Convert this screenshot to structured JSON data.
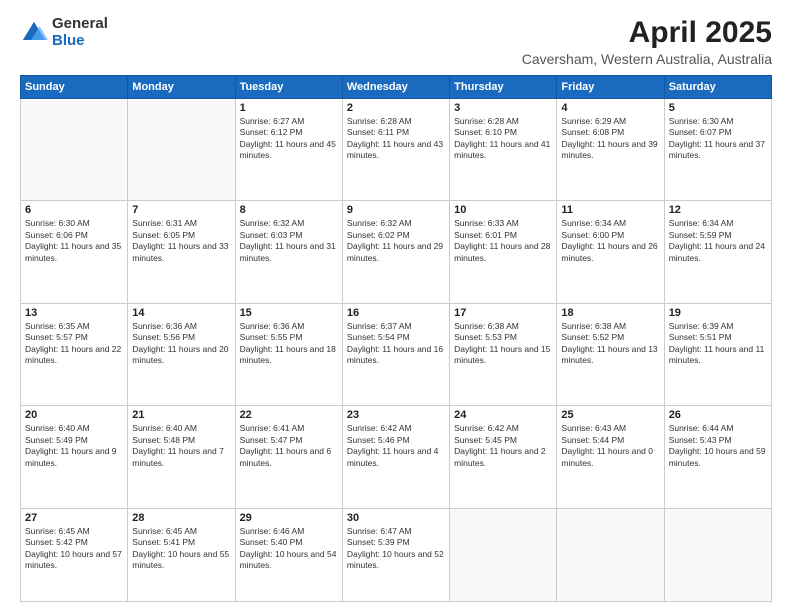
{
  "logo": {
    "general": "General",
    "blue": "Blue"
  },
  "title": {
    "month": "April 2025",
    "location": "Caversham, Western Australia, Australia"
  },
  "days_of_week": [
    "Sunday",
    "Monday",
    "Tuesday",
    "Wednesday",
    "Thursday",
    "Friday",
    "Saturday"
  ],
  "weeks": [
    [
      {
        "day": "",
        "info": ""
      },
      {
        "day": "",
        "info": ""
      },
      {
        "day": "1",
        "info": "Sunrise: 6:27 AM\nSunset: 6:12 PM\nDaylight: 11 hours and 45 minutes."
      },
      {
        "day": "2",
        "info": "Sunrise: 6:28 AM\nSunset: 6:11 PM\nDaylight: 11 hours and 43 minutes."
      },
      {
        "day": "3",
        "info": "Sunrise: 6:28 AM\nSunset: 6:10 PM\nDaylight: 11 hours and 41 minutes."
      },
      {
        "day": "4",
        "info": "Sunrise: 6:29 AM\nSunset: 6:08 PM\nDaylight: 11 hours and 39 minutes."
      },
      {
        "day": "5",
        "info": "Sunrise: 6:30 AM\nSunset: 6:07 PM\nDaylight: 11 hours and 37 minutes."
      }
    ],
    [
      {
        "day": "6",
        "info": "Sunrise: 6:30 AM\nSunset: 6:06 PM\nDaylight: 11 hours and 35 minutes."
      },
      {
        "day": "7",
        "info": "Sunrise: 6:31 AM\nSunset: 6:05 PM\nDaylight: 11 hours and 33 minutes."
      },
      {
        "day": "8",
        "info": "Sunrise: 6:32 AM\nSunset: 6:03 PM\nDaylight: 11 hours and 31 minutes."
      },
      {
        "day": "9",
        "info": "Sunrise: 6:32 AM\nSunset: 6:02 PM\nDaylight: 11 hours and 29 minutes."
      },
      {
        "day": "10",
        "info": "Sunrise: 6:33 AM\nSunset: 6:01 PM\nDaylight: 11 hours and 28 minutes."
      },
      {
        "day": "11",
        "info": "Sunrise: 6:34 AM\nSunset: 6:00 PM\nDaylight: 11 hours and 26 minutes."
      },
      {
        "day": "12",
        "info": "Sunrise: 6:34 AM\nSunset: 5:59 PM\nDaylight: 11 hours and 24 minutes."
      }
    ],
    [
      {
        "day": "13",
        "info": "Sunrise: 6:35 AM\nSunset: 5:57 PM\nDaylight: 11 hours and 22 minutes."
      },
      {
        "day": "14",
        "info": "Sunrise: 6:36 AM\nSunset: 5:56 PM\nDaylight: 11 hours and 20 minutes."
      },
      {
        "day": "15",
        "info": "Sunrise: 6:36 AM\nSunset: 5:55 PM\nDaylight: 11 hours and 18 minutes."
      },
      {
        "day": "16",
        "info": "Sunrise: 6:37 AM\nSunset: 5:54 PM\nDaylight: 11 hours and 16 minutes."
      },
      {
        "day": "17",
        "info": "Sunrise: 6:38 AM\nSunset: 5:53 PM\nDaylight: 11 hours and 15 minutes."
      },
      {
        "day": "18",
        "info": "Sunrise: 6:38 AM\nSunset: 5:52 PM\nDaylight: 11 hours and 13 minutes."
      },
      {
        "day": "19",
        "info": "Sunrise: 6:39 AM\nSunset: 5:51 PM\nDaylight: 11 hours and 11 minutes."
      }
    ],
    [
      {
        "day": "20",
        "info": "Sunrise: 6:40 AM\nSunset: 5:49 PM\nDaylight: 11 hours and 9 minutes."
      },
      {
        "day": "21",
        "info": "Sunrise: 6:40 AM\nSunset: 5:48 PM\nDaylight: 11 hours and 7 minutes."
      },
      {
        "day": "22",
        "info": "Sunrise: 6:41 AM\nSunset: 5:47 PM\nDaylight: 11 hours and 6 minutes."
      },
      {
        "day": "23",
        "info": "Sunrise: 6:42 AM\nSunset: 5:46 PM\nDaylight: 11 hours and 4 minutes."
      },
      {
        "day": "24",
        "info": "Sunrise: 6:42 AM\nSunset: 5:45 PM\nDaylight: 11 hours and 2 minutes."
      },
      {
        "day": "25",
        "info": "Sunrise: 6:43 AM\nSunset: 5:44 PM\nDaylight: 11 hours and 0 minutes."
      },
      {
        "day": "26",
        "info": "Sunrise: 6:44 AM\nSunset: 5:43 PM\nDaylight: 10 hours and 59 minutes."
      }
    ],
    [
      {
        "day": "27",
        "info": "Sunrise: 6:45 AM\nSunset: 5:42 PM\nDaylight: 10 hours and 57 minutes."
      },
      {
        "day": "28",
        "info": "Sunrise: 6:45 AM\nSunset: 5:41 PM\nDaylight: 10 hours and 55 minutes."
      },
      {
        "day": "29",
        "info": "Sunrise: 6:46 AM\nSunset: 5:40 PM\nDaylight: 10 hours and 54 minutes."
      },
      {
        "day": "30",
        "info": "Sunrise: 6:47 AM\nSunset: 5:39 PM\nDaylight: 10 hours and 52 minutes."
      },
      {
        "day": "",
        "info": ""
      },
      {
        "day": "",
        "info": ""
      },
      {
        "day": "",
        "info": ""
      }
    ]
  ]
}
